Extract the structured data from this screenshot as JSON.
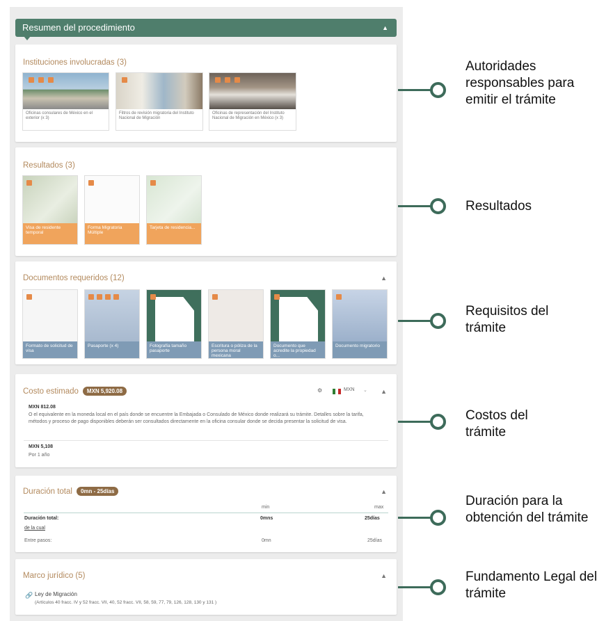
{
  "header": {
    "title": "Resumen del procedimiento",
    "caret": "▲"
  },
  "instituciones": {
    "title": "Instituciones involucradas (3)",
    "items": [
      {
        "caption": "Oficinas consulares de México en el exterior (x 3)"
      },
      {
        "caption": "Filtros de revisión migratoria del Instituto Nacional de Migración"
      },
      {
        "caption": "Oficinas de representación del Instituto Nacional de Migración en México (x 3)"
      }
    ]
  },
  "resultados": {
    "title": "Resultados (3)",
    "items": [
      {
        "caption": "Visa de residente temporal"
      },
      {
        "caption": "Forma Migratoria Múltiple"
      },
      {
        "caption": "Tarjeta de residencia..."
      }
    ]
  },
  "documentos": {
    "title": "Documentos requeridos (12)",
    "chevron": "▲",
    "items": [
      {
        "caption": "Formato de solicitud de visa"
      },
      {
        "caption": "Pasaporte (x 4)"
      },
      {
        "caption": "Fotografía tamaño pasaporte"
      },
      {
        "caption": "Escritura o póliza de la persona moral mexicana"
      },
      {
        "caption": "Documento que acredite la propiedad o..."
      },
      {
        "caption": "Documento migratorio"
      }
    ]
  },
  "costo": {
    "title": "Costo estimado",
    "badge": "MXN 5,920.08",
    "currency": "MXN",
    "chevron": "▲",
    "line1_amount": "MXN 812.08",
    "line1_text": "O el equivalente en la moneda local en el país donde se encuentre la Embajada o Consulado de México donde realizará su trámite. Detalles sobre la tarifa, métodos y proceso de pago disponibles deberán ser consultados directamente en la oficina consular donde se decida presentar la solicitud de visa.",
    "line2_amount": "MXN 5,108",
    "line2_text": "Por 1 año"
  },
  "duracion": {
    "title": "Duración total",
    "badge": "0mn - 25días",
    "chevron": "▲",
    "col_min": "min",
    "col_max": "max",
    "row_label": "Duración total:",
    "row_min": "0mns",
    "row_max": "25días",
    "link": "de la cual",
    "sub_label": "Entre pasos:",
    "sub_min": "0mn",
    "sub_max": "25días"
  },
  "marco": {
    "title": "Marco jurídico (5)",
    "chevron": "▲",
    "law": "Ley de Migración",
    "articles": "(Artículos 40 fracc. IV y 52 fracc. VII, 40, 52 fracc. VII, 58, 59, 77, 79, 126, 128, 130 y 131 )"
  },
  "annotations": [
    {
      "label": "Autoridades responsables para emitir el trámite"
    },
    {
      "label": "Resultados"
    },
    {
      "label": "Requisitos del trámite"
    },
    {
      "label": "Costos del trámite"
    },
    {
      "label": "Duración para la obtención del trámite"
    },
    {
      "label": "Fundamento Legal del trámite"
    }
  ],
  "colors": {
    "header_green": "#4f7e6c",
    "accent_brown": "#8e6b45",
    "title_tan": "#b38a5e",
    "orange_caption": "#f0a45c",
    "blue_caption": "#7f9bb5",
    "connector_green": "#3d6b5a"
  }
}
